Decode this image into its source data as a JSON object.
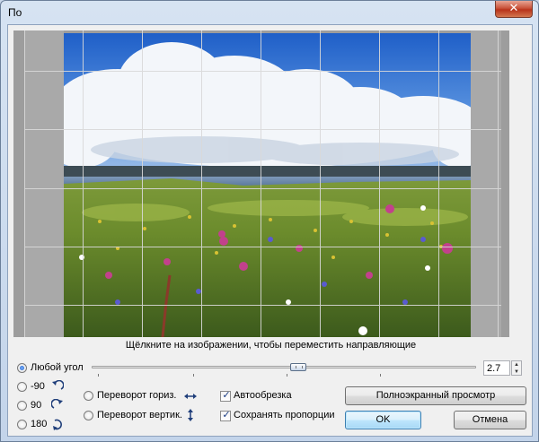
{
  "window": {
    "title": "По",
    "close_glyph": "✕"
  },
  "preview": {
    "hint": "Щёлкните на изображении, чтобы переместить направляющие",
    "image_description_icon": "landscape-photo"
  },
  "rotation": {
    "any_angle_label": "Любой угол",
    "options": [
      {
        "label": "-90",
        "icon": "rotate-ccw-icon"
      },
      {
        "label": "90",
        "icon": "rotate-cw-icon"
      },
      {
        "label": "180",
        "icon": "rotate-180-icon"
      }
    ],
    "selected": "any_angle",
    "angle_value": "2.7",
    "spin_up": "▲",
    "spin_down": "▼"
  },
  "flip": {
    "horizontal_label": "Переворот гориз.",
    "vertical_label": "Переворот вертик.",
    "horizontal_icon": "flip-horizontal-icon",
    "vertical_icon": "flip-vertical-icon"
  },
  "options": {
    "autocrop_label": "Автообрезка",
    "autocrop_checked": true,
    "keep_proportions_label": "Сохранять пропорции",
    "keep_proportions_checked": true,
    "check_glyph": "✓"
  },
  "buttons": {
    "fullscreen_label": "Полноэкранный просмотр",
    "ok_label": "OK",
    "cancel_label": "Отмена"
  },
  "colors": {
    "sky": "#2f6fd0",
    "cloud": "#f4f7fb",
    "sea": "#5f7fa2",
    "meadow": "#5b7f2a",
    "accent_default_button": "#3c7fb1"
  }
}
